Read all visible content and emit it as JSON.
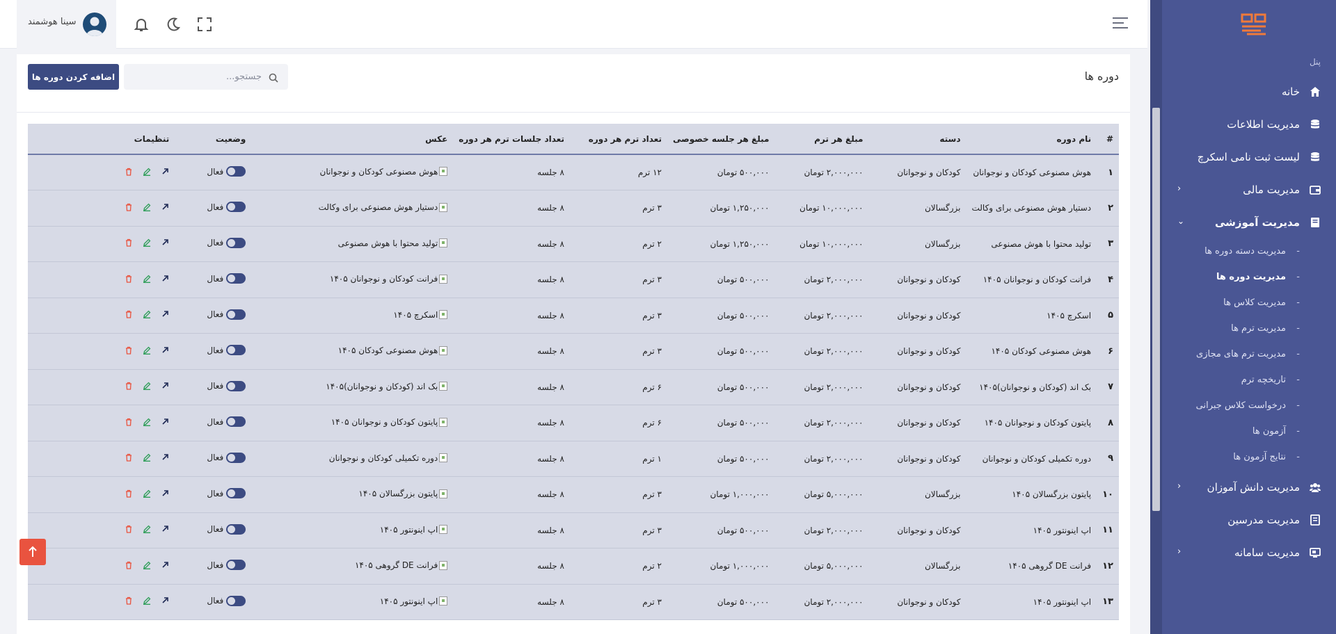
{
  "header": {
    "user_name": "سینا هوشمند"
  },
  "sidebar": {
    "panel_label": "پنل",
    "items": [
      {
        "label": "خانه",
        "icon": "home-icon"
      },
      {
        "label": "مدیریت اطلاعات",
        "icon": "database-icon"
      },
      {
        "label": "لیست ثبت نامی اسکرچ",
        "icon": "database-icon"
      },
      {
        "label": "مدیریت مالی",
        "icon": "wallet-icon"
      },
      {
        "label": "مدیریت آموزشی",
        "icon": "book-icon"
      },
      {
        "label": "مدیریت دانش آموزان",
        "icon": "users-icon"
      },
      {
        "label": "مدیریت مدرسین",
        "icon": "book-icon"
      },
      {
        "label": "مدیریت سامانه",
        "icon": "monitor-icon"
      }
    ],
    "sub_items": [
      "مدیریت دسته دوره ها",
      "مدیریت دوره ها",
      "مدیریت کلاس ها",
      "مدیریت ترم ها",
      "مدیریت ترم های مجازی",
      "تاریخچه ترم",
      "درخواست کلاس جبرانی",
      "آزمون ها",
      "نتایج آزمون ها"
    ],
    "active_sub": "مدیریت دوره ها"
  },
  "toolbar": {
    "page_title": "دوره ها",
    "search_placeholder": "جستجو...",
    "add_label": "اضافه کردن دوره ها"
  },
  "table": {
    "headers": [
      "#",
      "نام دوره",
      "دسته",
      "مبلغ هر ترم",
      "مبلغ هر جلسه خصوصی",
      "تعداد ترم هر دوره",
      "تعداد جلسات ترم هر دوره",
      "عکس",
      "وضعیت",
      "تنظیمات"
    ],
    "status_label": "فعال",
    "rows": [
      {
        "num": "۱",
        "name": "هوش مصنوعی کودکان و نوجوانان",
        "category": "کودکان و نوجوانان",
        "term_price": "۲,۰۰۰,۰۰۰ تومان",
        "session_price": "۵۰۰,۰۰۰ تومان",
        "terms": "۱۲ ترم",
        "sessions": "۸ جلسه",
        "image_alt": "هوش مصنوعی کودکان و نوجوانان"
      },
      {
        "num": "۲",
        "name": "دستیار هوش مصنوعی برای وکالت",
        "category": "بزرگسالان",
        "term_price": "۱۰,۰۰۰,۰۰۰ تومان",
        "session_price": "۱,۲۵۰,۰۰۰ تومان",
        "terms": "۳ ترم",
        "sessions": "۸ جلسه",
        "image_alt": "دستیار هوش مصنوعی برای وکالت"
      },
      {
        "num": "۳",
        "name": "تولید محتوا با هوش مصنوعی",
        "category": "بزرگسالان",
        "term_price": "۱۰,۰۰۰,۰۰۰ تومان",
        "session_price": "۱,۲۵۰,۰۰۰ تومان",
        "terms": "۲ ترم",
        "sessions": "۸ جلسه",
        "image_alt": "تولید محتوا با هوش مصنوعی"
      },
      {
        "num": "۴",
        "name": "فرانت کودکان و نوجوانان ۱۴۰۵",
        "category": "کودکان و نوجوانان",
        "term_price": "۲,۰۰۰,۰۰۰ تومان",
        "session_price": "۵۰۰,۰۰۰ تومان",
        "terms": "۳ ترم",
        "sessions": "۸ جلسه",
        "image_alt": "فرانت کودکان و نوجوانان ۱۴۰۵"
      },
      {
        "num": "۵",
        "name": "اسکرچ ۱۴۰۵",
        "category": "کودکان و نوجوانان",
        "term_price": "۲,۰۰۰,۰۰۰ تومان",
        "session_price": "۵۰۰,۰۰۰ تومان",
        "terms": "۳ ترم",
        "sessions": "۸ جلسه",
        "image_alt": "اسکرچ ۱۴۰۵"
      },
      {
        "num": "۶",
        "name": "هوش مصنوعی کودکان ۱۴۰۵",
        "category": "کودکان و نوجوانان",
        "term_price": "۲,۰۰۰,۰۰۰ تومان",
        "session_price": "۵۰۰,۰۰۰ تومان",
        "terms": "۳ ترم",
        "sessions": "۸ جلسه",
        "image_alt": "هوش مصنوعی کودکان ۱۴۰۵"
      },
      {
        "num": "۷",
        "name": "بک اند (کودکان و نوجوانان)۱۴۰۵",
        "category": "کودکان و نوجوانان",
        "term_price": "۲,۰۰۰,۰۰۰ تومان",
        "session_price": "۵۰۰,۰۰۰ تومان",
        "terms": "۶ ترم",
        "sessions": "۸ جلسه",
        "image_alt": "بک اند (کودکان و نوجوانان)۱۴۰۵"
      },
      {
        "num": "۸",
        "name": "پایتون کودکان و نوجوانان ۱۴۰۵",
        "category": "کودکان و نوجوانان",
        "term_price": "۲,۰۰۰,۰۰۰ تومان",
        "session_price": "۵۰۰,۰۰۰ تومان",
        "terms": "۶ ترم",
        "sessions": "۸ جلسه",
        "image_alt": "پایتون کودکان و نوجوانان ۱۴۰۵"
      },
      {
        "num": "۹",
        "name": "دوره تکمیلی کودکان و نوجوانان",
        "category": "کودکان و نوجوانان",
        "term_price": "۲,۰۰۰,۰۰۰ تومان",
        "session_price": "۵۰۰,۰۰۰ تومان",
        "terms": "۱ ترم",
        "sessions": "۸ جلسه",
        "image_alt": "دوره تکمیلی کودکان و نوجوانان"
      },
      {
        "num": "۱۰",
        "name": "پایتون بزرگسالان ۱۴۰۵",
        "category": "بزرگسالان",
        "term_price": "۵,۰۰۰,۰۰۰ تومان",
        "session_price": "۱,۰۰۰,۰۰۰ تومان",
        "terms": "۳ ترم",
        "sessions": "۸ جلسه",
        "image_alt": "پایتون بزرگسالان ۱۴۰۵"
      },
      {
        "num": "۱۱",
        "name": "اپ اینونتور ۱۴۰۵",
        "category": "کودکان و نوجوانان",
        "term_price": "۲,۰۰۰,۰۰۰ تومان",
        "session_price": "۵۰۰,۰۰۰ تومان",
        "terms": "۳ ترم",
        "sessions": "۸ جلسه",
        "image_alt": "اپ اینونتور ۱۴۰۵"
      },
      {
        "num": "۱۲",
        "name": "فرانت DE گروهی ۱۴۰۵",
        "category": "بزرگسالان",
        "term_price": "۵,۰۰۰,۰۰۰ تومان",
        "session_price": "۱,۰۰۰,۰۰۰ تومان",
        "terms": "۲ ترم",
        "sessions": "۸ جلسه",
        "image_alt": "فرانت DE گروهی ۱۴۰۵"
      },
      {
        "num": "۱۳",
        "name": "اپ اینونتور ۱۴۰۵",
        "category": "کودکان و نوجوانان",
        "term_price": "۲,۰۰۰,۰۰۰ تومان",
        "session_price": "۵۰۰,۰۰۰ تومان",
        "terms": "۳ ترم",
        "sessions": "۸ جلسه",
        "image_alt": "اپ اینونتور ۱۴۰۵"
      }
    ]
  },
  "colors": {
    "sidebar": "#4a5694",
    "primary": "#3c4b82",
    "table_bg": "#d7dae6",
    "danger": "#e9533f",
    "edit": "#2f9e59"
  }
}
